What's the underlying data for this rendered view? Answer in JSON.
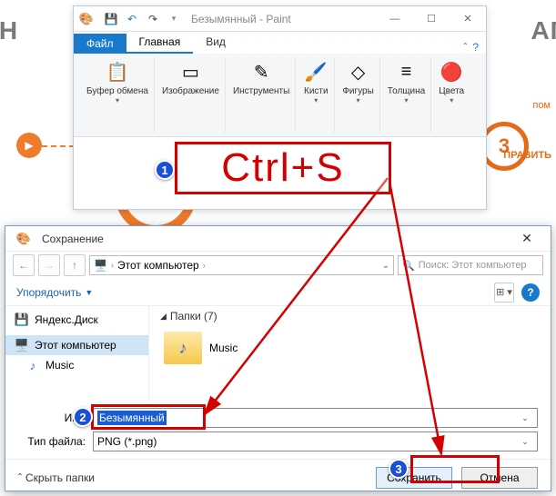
{
  "bg": {
    "left_word": "КРИН",
    "right_word": "АГА",
    "step3_num": "3",
    "step3_label": "ПРАВИТЬ",
    "pom": "пом"
  },
  "paint": {
    "doc_title": "Безымянный - Paint",
    "tabs": {
      "file": "Файл",
      "home": "Главная",
      "view": "Вид"
    },
    "ribbon": {
      "clipboard": "Буфер\nобмена",
      "image": "Изображение",
      "tools": "Инструменты",
      "brushes": "Кисти",
      "shapes": "Фигуры",
      "size": "Толщина",
      "colors": "Цвета"
    }
  },
  "annotation": {
    "ctrl_s": "Ctrl+S",
    "b1": "1",
    "b2": "2",
    "b3": "3"
  },
  "dialog": {
    "title": "Сохранение",
    "breadcrumb": "Этот компьютер",
    "search_placeholder": "Поиск: Этот компьютер",
    "organize": "Упорядочить",
    "tree": {
      "yadisk": "Яндекс.Диск",
      "thispc": "Этот компьютер",
      "music": "Music"
    },
    "folders_header": "Папки (7)",
    "folder_music": "Music",
    "filename_label": "Имя",
    "filename_value": "Безымянный",
    "filetype_label": "Тип файла:",
    "filetype_value": "PNG (*.png)",
    "hide_folders": "Скрыть папки",
    "save_btn": "Сохранить",
    "cancel_btn": "Отмена"
  }
}
